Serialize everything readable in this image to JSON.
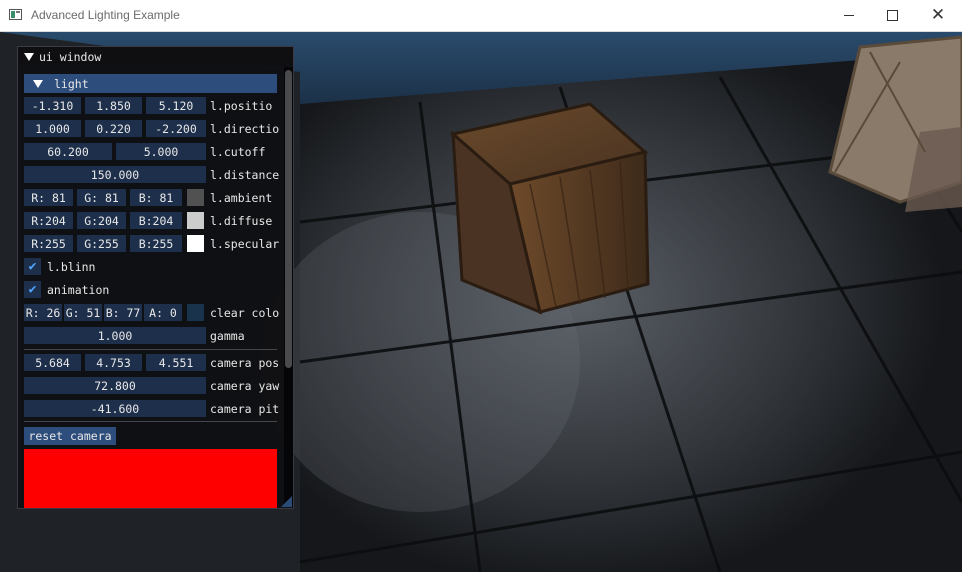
{
  "window": {
    "title": "Advanced Lighting Example",
    "controls": {
      "minimize": "minimize-icon",
      "maximize": "maximize-icon",
      "close": "close-icon"
    }
  },
  "ui_window": {
    "title": "ui window",
    "light_header": "light",
    "position": {
      "values": [
        "-1.310",
        "1.850",
        "5.120"
      ],
      "label": "l.positio"
    },
    "direction": {
      "values": [
        "1.000",
        "0.220",
        "-2.200"
      ],
      "label": "l.directio"
    },
    "cutoff": {
      "values": [
        "60.200",
        "5.000"
      ],
      "label": "l.cutoff"
    },
    "distance": {
      "value": "150.000",
      "label": "l.distance"
    },
    "ambient": {
      "values": [
        "R: 81",
        "G: 81",
        "B: 81"
      ],
      "label": "l.ambient",
      "swatch": "#515151"
    },
    "diffuse": {
      "values": [
        "R:204",
        "G:204",
        "B:204"
      ],
      "label": "l.diffuse",
      "swatch": "#cccccc"
    },
    "specular": {
      "values": [
        "R:255",
        "G:255",
        "B:255"
      ],
      "label": "l.specular",
      "swatch": "#ffffff"
    },
    "blinn": {
      "label": "l.blinn",
      "checked": true
    },
    "animation": {
      "label": "animation",
      "checked": true
    },
    "clear_color": {
      "values": [
        "R: 26",
        "G: 51",
        "B: 77",
        "A:  0"
      ],
      "label": "clear colo",
      "swatch": "#1a334d"
    },
    "gamma": {
      "value": "1.000",
      "label": "gamma"
    },
    "camera_pos": {
      "values": [
        "5.684",
        "4.753",
        "4.551"
      ],
      "label": "camera pos"
    },
    "camera_yaw": {
      "value": "72.800",
      "label": "camera yaw"
    },
    "camera_pitch": {
      "value": "-41.600",
      "label": "camera pit"
    },
    "reset_button": "reset camera",
    "preview_color": "#ff0000"
  },
  "colors": {
    "accent": "#2d4d7c",
    "frame_bg": "#1d2f4a",
    "checkmark": "#4fa3ff"
  }
}
